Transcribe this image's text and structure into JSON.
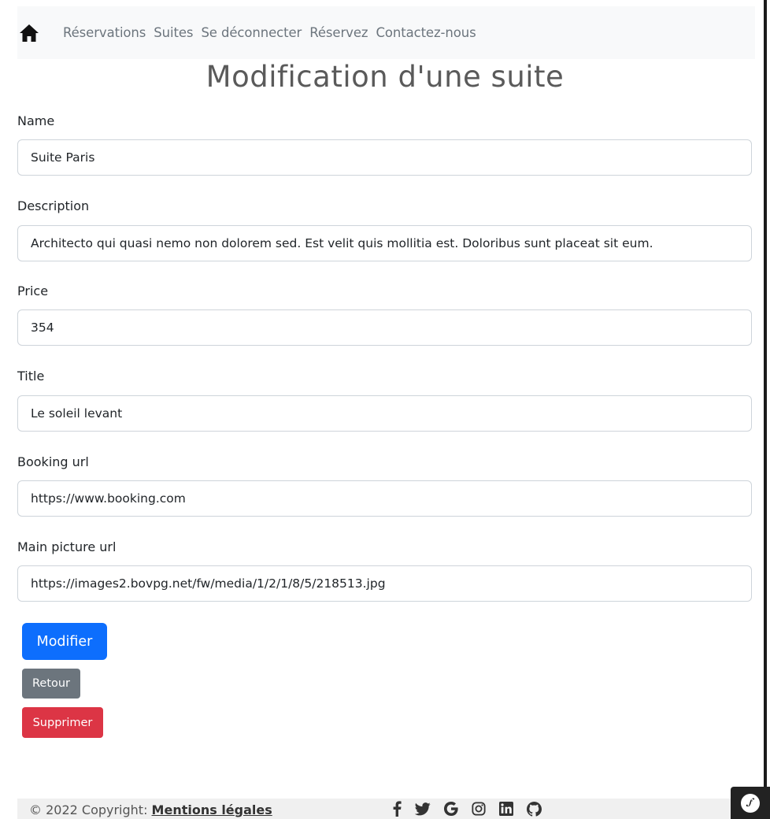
{
  "nav": {
    "items": [
      {
        "label": "Réservations"
      },
      {
        "label": "Suites"
      },
      {
        "label": "Se déconnecter"
      },
      {
        "label": "Réservez"
      },
      {
        "label": "Contactez-nous"
      }
    ]
  },
  "page": {
    "title": "Modification d'une suite"
  },
  "form": {
    "name": {
      "label": "Name",
      "value": "Suite Paris"
    },
    "description": {
      "label": "Description",
      "value": "Architecto qui quasi nemo non dolorem sed. Est velit quis mollitia est. Doloribus sunt placeat sit eum."
    },
    "price": {
      "label": "Price",
      "value": "354"
    },
    "title": {
      "label": "Title",
      "value": "Le soleil levant"
    },
    "booking_url": {
      "label": "Booking url",
      "value": "https://www.booking.com"
    },
    "main_picture_url": {
      "label": "Main picture url",
      "value": "https://images2.bovpg.net/fw/media/1/2/1/8/5/218513.jpg"
    }
  },
  "buttons": {
    "modify": "Modifier",
    "back": "Retour",
    "delete": "Supprimer"
  },
  "footer": {
    "copyright": "© 2022 Copyright: ",
    "legal_link": "Mentions légales",
    "social_icons": [
      "facebook-icon",
      "twitter-icon",
      "google-icon",
      "instagram-icon",
      "linkedin-icon",
      "github-icon"
    ]
  },
  "colors": {
    "primary": "#0d6efd",
    "secondary": "#6c757d",
    "danger": "#dc3545",
    "navbar_bg": "#f8f9fa"
  }
}
